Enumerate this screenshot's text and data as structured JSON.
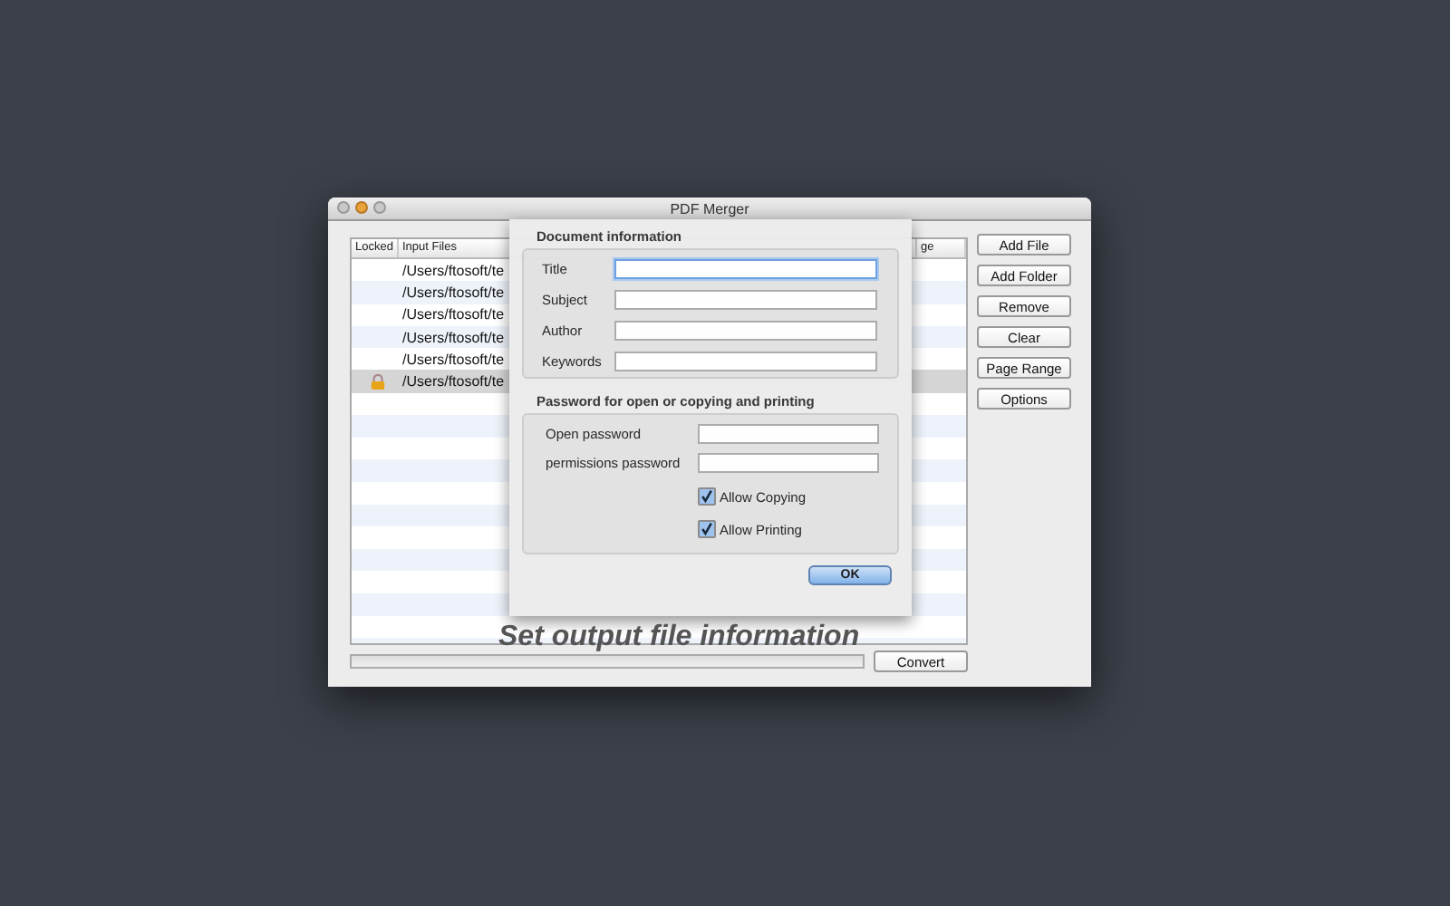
{
  "window": {
    "title": "PDF Merger"
  },
  "table": {
    "columns": [
      {
        "label": "Locked"
      },
      {
        "label": "Input Files"
      },
      {
        "label": "ge"
      }
    ],
    "rows": [
      {
        "path": "/Users/ftosoft/te",
        "locked": false,
        "selected": false
      },
      {
        "path": "/Users/ftosoft/te",
        "locked": false,
        "selected": false
      },
      {
        "path": "/Users/ftosoft/te",
        "locked": false,
        "selected": false
      },
      {
        "path": "/Users/ftosoft/te",
        "locked": false,
        "selected": false
      },
      {
        "path": "/Users/ftosoft/te",
        "locked": false,
        "selected": false
      },
      {
        "path": "/Users/ftosoft/te",
        "locked": true,
        "selected": true
      }
    ]
  },
  "buttons": [
    "Add File",
    "Add Folder",
    "Remove",
    "Clear",
    "Page Range",
    "Options"
  ],
  "progress": {
    "level": 0
  },
  "convert_button": "Convert",
  "caption": "Set output file information",
  "dialog": {
    "document_heading": "Document information",
    "document_fields": [
      {
        "label": "Title",
        "focused": true
      },
      {
        "label": "Subject",
        "focused": false
      },
      {
        "label": "Author",
        "focused": false
      },
      {
        "label": "Keywords",
        "focused": false
      }
    ],
    "password_heading": "Password for open or copying and printing",
    "password_fields": [
      {
        "label": "Open password"
      },
      {
        "label": "permissions password"
      }
    ],
    "checkboxes": [
      {
        "label": "Allow Copying",
        "checked": true
      },
      {
        "label": "Allow Printing",
        "checked": true
      }
    ],
    "ok_button": "OK"
  }
}
